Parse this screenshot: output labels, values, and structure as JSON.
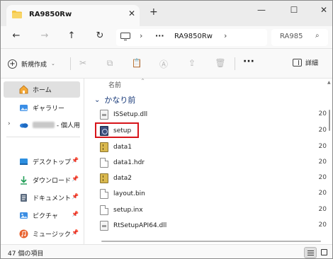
{
  "window": {
    "tab_title": "RA9850Rw",
    "tab_close": "✕",
    "tab_new": "+",
    "minimize": "—",
    "maximize": "☐",
    "close": "✕"
  },
  "navbar": {
    "back": "←",
    "forward": "→",
    "up": "↑",
    "refresh": "↻",
    "address_sep1": "›",
    "address_ellipsis": "···",
    "address_folder": "RA9850Rw",
    "address_sep2": "›",
    "search_placeholder": "RA985",
    "search_icon": "⌕"
  },
  "commandbar": {
    "new_plus": "+",
    "new_label": "新規作成",
    "new_caret": "⌄",
    "icons": [
      "cut-icon",
      "copy-icon",
      "paste-icon",
      "rename-icon",
      "share-icon",
      "delete-icon"
    ],
    "icon_glyphs": {
      "cut": "✂",
      "copy": "⧉",
      "paste": "📋",
      "rename": "Ⓐ",
      "share": "⇪",
      "delete": "🗑"
    },
    "more": "···",
    "details_label": "詳細"
  },
  "navpane": {
    "items": [
      {
        "label": "ホーム",
        "icon": "home-icon",
        "selected": true,
        "pinned": false
      },
      {
        "label": "ギャラリー",
        "icon": "gallery-icon",
        "selected": false,
        "pinned": false
      },
      {
        "label": "- 個人用",
        "icon": "onedrive-icon",
        "selected": false,
        "pinned": false,
        "expandable": true
      },
      {
        "label": "デスクトップ",
        "icon": "desktop-icon",
        "selected": false,
        "pinned": true
      },
      {
        "label": "ダウンロード",
        "icon": "download-icon",
        "selected": false,
        "pinned": true
      },
      {
        "label": "ドキュメント",
        "icon": "documents-icon",
        "selected": false,
        "pinned": true
      },
      {
        "label": "ピクチャ",
        "icon": "pictures-icon",
        "selected": false,
        "pinned": true
      },
      {
        "label": "ミュージック",
        "icon": "music-icon",
        "selected": false,
        "pinned": true
      }
    ],
    "chevron": "›",
    "pin_glyph": "📌"
  },
  "filelist": {
    "column_header": "名前",
    "sort_arrow": "^",
    "group_chevron": "⌄",
    "group_label": "かなり前",
    "files": [
      {
        "name": "ISSetup.dll",
        "type": "dll",
        "col": "20"
      },
      {
        "name": "setup",
        "type": "exe",
        "col": "20",
        "highlighted": true
      },
      {
        "name": "data1",
        "type": "cab",
        "col": "20"
      },
      {
        "name": "data1.hdr",
        "type": "doc",
        "col": "20"
      },
      {
        "name": "data2",
        "type": "cab",
        "col": "20"
      },
      {
        "name": "layout.bin",
        "type": "doc",
        "col": "20"
      },
      {
        "name": "setup.inx",
        "type": "doc",
        "col": "20"
      },
      {
        "name": "RtSetupAPI64.dll",
        "type": "dll",
        "col": "20"
      }
    ]
  },
  "statusbar": {
    "item_count": "47 個の項目"
  },
  "colors": {
    "accent_folder": "#f4c542",
    "highlight": "#d7141a",
    "group_header": "#1a3b7a"
  }
}
